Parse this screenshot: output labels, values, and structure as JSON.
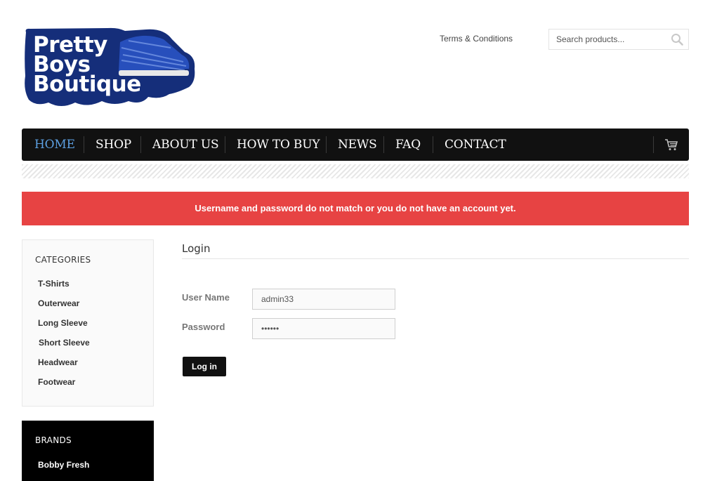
{
  "logo": {
    "lines": [
      "Pretty",
      "Boys",
      "Boutique"
    ],
    "colors": {
      "navy": "#152e7a",
      "accent": "#2a55c8"
    }
  },
  "header": {
    "terms_label": "Terms & Conditions",
    "search_placeholder": "Search products..."
  },
  "nav": {
    "items": [
      "HOME",
      "SHOP",
      "ABOUT US",
      "HOW TO BUY",
      "NEWS",
      "FAQ",
      "CONTACT"
    ],
    "active_index": 0,
    "colors": {
      "bar": "#111111",
      "active": "#5c9fe0"
    }
  },
  "alert": {
    "message": "Username and password do not match or you do not have an account yet.",
    "color": "#e74343"
  },
  "categories": {
    "title": "CATEGORIES",
    "items": [
      "T-Shirts",
      "Outerwear",
      "Long Sleeve",
      "Short Sleeve",
      "Headwear",
      "Footwear"
    ]
  },
  "brands": {
    "title": "BRANDS",
    "items": [
      "Bobby Fresh"
    ]
  },
  "login": {
    "title": "Login",
    "username_label": "User Name",
    "username_value": "admin33",
    "password_label": "Password",
    "password_value": "••••••",
    "submit_label": "Log in"
  }
}
